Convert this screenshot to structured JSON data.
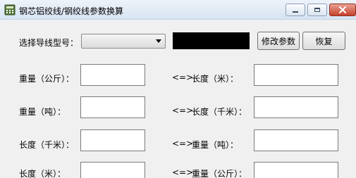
{
  "window": {
    "title": "钢芯铝绞线/钢绞线参数换算"
  },
  "selector": {
    "label": "选择导线型号：",
    "value": ""
  },
  "buttons": {
    "modify": "修改参数",
    "restore": "恢复"
  },
  "rows": [
    {
      "left": "重量（公斤）：",
      "arrow": "<=>",
      "right": "长度（米）："
    },
    {
      "left": "重量（吨）：",
      "arrow": "<=>",
      "right": "长度（千米）："
    },
    {
      "left": "长度（千米）：",
      "arrow": "<=>",
      "right": "重量（吨）："
    },
    {
      "left": "长度（米）：",
      "arrow": "<=>",
      "right": "重量（公斤）："
    }
  ],
  "icons": {
    "app": "calculator-icon",
    "minimize": "minimize-icon",
    "maximize": "maximize-icon",
    "close": "close-icon",
    "dropdown": "chevron-down-icon"
  }
}
